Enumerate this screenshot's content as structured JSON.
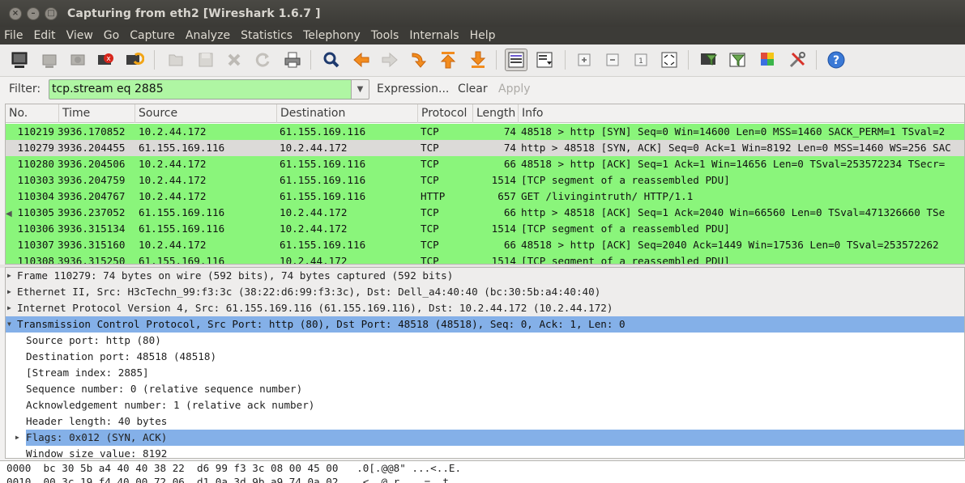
{
  "window": {
    "title": "Capturing from eth2   [Wireshark 1.6.7 ]",
    "buttons": [
      "×",
      "–",
      "□"
    ]
  },
  "menu": [
    "File",
    "Edit",
    "View",
    "Go",
    "Capture",
    "Analyze",
    "Statistics",
    "Telephony",
    "Tools",
    "Internals",
    "Help"
  ],
  "toolbar": {
    "icons": [
      "interface-list-icon",
      "capture-options-icon",
      "start-capture-icon",
      "stop-capture-icon",
      "restart-capture-icon",
      "open-file-icon",
      "save-file-icon",
      "close-file-icon",
      "reload-icon",
      "print-icon",
      "find-packet-icon",
      "go-back-icon",
      "go-forward-icon",
      "go-to-packet-icon",
      "go-first-icon",
      "go-last-icon",
      "colorize-icon",
      "auto-scroll-icon",
      "zoom-in-icon",
      "zoom-out-icon",
      "zoom-normal-icon",
      "resize-columns-icon",
      "capture-filters-icon",
      "display-filters-icon",
      "coloring-rules-icon",
      "preferences-icon",
      "help-icon"
    ]
  },
  "filter": {
    "label": "Filter:",
    "value": "tcp.stream eq 2885",
    "expression_label": "Expression...",
    "clear_label": "Clear",
    "apply_label": "Apply"
  },
  "packet_list": {
    "columns": [
      "No.",
      "Time",
      "Source",
      "Destination",
      "Protocol",
      "Length",
      "Info"
    ],
    "rows": [
      {
        "no": "110219",
        "time": "3936.170852",
        "src": "10.2.44.172",
        "dst": "61.155.169.116",
        "proto": "TCP",
        "len": "74",
        "info": "48518 > http [SYN] Seq=0 Win=14600 Len=0 MSS=1460 SACK_PERM=1 TSval=2",
        "color": "#8af57b"
      },
      {
        "no": "110279",
        "time": "3936.204455",
        "src": "61.155.169.116",
        "dst": "10.2.44.172",
        "proto": "TCP",
        "len": "74",
        "info": "http > 48518 [SYN, ACK] Seq=0 Ack=1 Win=8192 Len=0 MSS=1460 WS=256 SAC",
        "color": "#dcdad8"
      },
      {
        "no": "110280",
        "time": "3936.204506",
        "src": "10.2.44.172",
        "dst": "61.155.169.116",
        "proto": "TCP",
        "len": "66",
        "info": "48518 > http [ACK] Seq=1 Ack=1 Win=14656 Len=0 TSval=253572234 TSecr=",
        "color": "#8af57b"
      },
      {
        "no": "110303",
        "time": "3936.204759",
        "src": "10.2.44.172",
        "dst": "61.155.169.116",
        "proto": "TCP",
        "len": "1514",
        "info": "[TCP segment of a reassembled PDU]",
        "color": "#8af57b"
      },
      {
        "no": "110304",
        "time": "3936.204767",
        "src": "10.2.44.172",
        "dst": "61.155.169.116",
        "proto": "HTTP",
        "len": "657",
        "info": "GET /livingintruth/ HTTP/1.1",
        "color": "#8af57b"
      },
      {
        "no": "110305",
        "time": "3936.237052",
        "src": "61.155.169.116",
        "dst": "10.2.44.172",
        "proto": "TCP",
        "len": "66",
        "info": "http > 48518 [ACK] Seq=1 Ack=2040 Win=66560 Len=0 TSval=471326660 TSe",
        "color": "#8af57b"
      },
      {
        "no": "110306",
        "time": "3936.315134",
        "src": "61.155.169.116",
        "dst": "10.2.44.172",
        "proto": "TCP",
        "len": "1514",
        "info": "[TCP segment of a reassembled PDU]",
        "color": "#8af57b"
      },
      {
        "no": "110307",
        "time": "3936.315160",
        "src": "10.2.44.172",
        "dst": "61.155.169.116",
        "proto": "TCP",
        "len": "66",
        "info": "48518 > http [ACK] Seq=2040 Ack=1449 Win=17536 Len=0 TSval=253572262",
        "color": "#8af57b"
      },
      {
        "no": "110308",
        "time": "3936.315250",
        "src": "61.155.169.116",
        "dst": "10.2.44.172",
        "proto": "TCP",
        "len": "1514",
        "info": "[TCP segment of a reassembled PDU]",
        "color": "#8af57b"
      }
    ]
  },
  "details": [
    {
      "text": "Frame 110279: 74 bytes on wire (592 bits), 74 bytes captured (592 bits)",
      "expander": "▶",
      "style": "hdr"
    },
    {
      "text": "Ethernet II, Src: H3cTechn_99:f3:3c (38:22:d6:99:f3:3c), Dst: Dell_a4:40:40 (bc:30:5b:a4:40:40)",
      "expander": "▶",
      "style": "hdr"
    },
    {
      "text": "Internet Protocol Version 4, Src: 61.155.169.116 (61.155.169.116), Dst: 10.2.44.172 (10.2.44.172)",
      "expander": "▶",
      "style": "hdr"
    },
    {
      "text": "Transmission Control Protocol, Src Port: http (80), Dst Port: 48518 (48518), Seq: 0, Ack: 1, Len: 0",
      "expander": "▼",
      "style": "sel"
    },
    {
      "text": "Source port: http (80)",
      "expander": "",
      "style": "child"
    },
    {
      "text": "Destination port: 48518 (48518)",
      "expander": "",
      "style": "child"
    },
    {
      "text": "[Stream index: 2885]",
      "expander": "",
      "style": "child"
    },
    {
      "text": "Sequence number: 0    (relative sequence number)",
      "expander": "",
      "style": "child"
    },
    {
      "text": "Acknowledgement number: 1    (relative ack number)",
      "expander": "",
      "style": "child"
    },
    {
      "text": "Header length: 40 bytes",
      "expander": "",
      "style": "child"
    },
    {
      "text": "Flags: 0x012 (SYN, ACK)",
      "expander": "▶",
      "style": "childsel"
    },
    {
      "text": "Window size value: 8192",
      "expander": "",
      "style": "child"
    }
  ],
  "bytes": [
    "0000  bc 30 5b a4 40 40 38 22  d6 99 f3 3c 08 00 45 00   .0[.@@8\" ...<..E.",
    "0010  00 3c 19 f4 40 00 72 06  d1 0a 3d 9b a9 74 0a 02   .<..@.r. ..=..t.."
  ]
}
